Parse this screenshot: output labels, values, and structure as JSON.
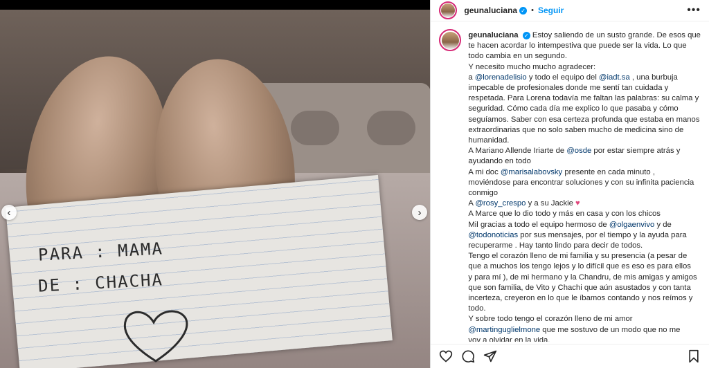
{
  "post": {
    "username": "geunaluciana",
    "follow_label": "Seguir",
    "separator": "•",
    "more_label": "•••",
    "paper_line1": "PARA : MAMA",
    "paper_line2": "DE : CHACHA"
  },
  "caption": {
    "l1": "Estoy saliendo de un susto grande. De esos que",
    "l2": "te hacen acordar lo intempestiva que puede ser la vida. Lo que",
    "l3": "todo cambia en un segundo.",
    "l4": "Y necesito mucho mucho agradecer:",
    "l5a": "a ",
    "l5b": "@lorenadelisio",
    "l5c": " y todo el equipo del ",
    "l5d": "@iadt.sa",
    "l5e": " , una burbuja",
    "l6": "impecable de profesionales donde me sentí tan cuidada y",
    "l7": "respetada. Para Lorena todavía me faltan las palabras: su calma y",
    "l8": "seguridad. Cómo cada día me explico lo que pasaba y cómo",
    "l9": "seguíamos. Saber con esa certeza profunda que estaba en manos",
    "l10": "extraordinarias que no solo saben mucho de medicina sino de",
    "l11": "humanidad.",
    "l12a": "A Mariano Allende Iriarte de ",
    "l12b": "@osde",
    "l12c": " por estar siempre atrás y",
    "l13": "ayudando en todo",
    "l14a": "A mi doc ",
    "l14b": "@marisalabovsky",
    "l14c": " presente en cada minuto ,",
    "l15": "moviéndose para encontrar soluciones y con su infinita paciencia",
    "l16": "conmigo",
    "l17a": "A ",
    "l17b": "@rosy_crespo",
    "l17c": " y a su Jackie ",
    "l17d": "♥",
    "l18": "A Marce que lo dio todo y más en casa y con los chicos",
    "l19a": "Mil gracias a todo el equipo hermoso de ",
    "l19b": "@olgaenvivo",
    "l19c": " y de",
    "l20a": "@todonoticias",
    "l20b": " por sus mensajes, por el tiempo y la ayuda para",
    "l21": "recuperarme . Hay tanto lindo para decir de todos.",
    "l22": "Tengo el corazón lleno de mi familia y su presencia (a pesar de",
    "l23": "que a muchos los tengo lejos y lo difícil que es eso es para ellos",
    "l24": "y para mí ), de mi hermano y la Chandru, de mis amigas y amigos",
    "l25": "que son familia, de Vito y Chachi que aún asustados y con tanta",
    "l26": "incerteza, creyeron en lo que le íbamos contando y nos reímos y",
    "l27": "todo.",
    "l28": "Y sobre todo tengo el corazón lleno de mi amor",
    "l29a": "@martinguglielmone",
    "l29b": " que me sostuvo de un modo que no me",
    "l30": "voy a olvidar en la vida."
  },
  "icons": {
    "heart": "heart-icon",
    "comment": "comment-icon",
    "share": "share-icon",
    "save": "bookmark-icon",
    "verified": "verified-badge-icon"
  },
  "colors": {
    "link": "#00376b",
    "follow": "#0095f6",
    "text": "#262626"
  }
}
